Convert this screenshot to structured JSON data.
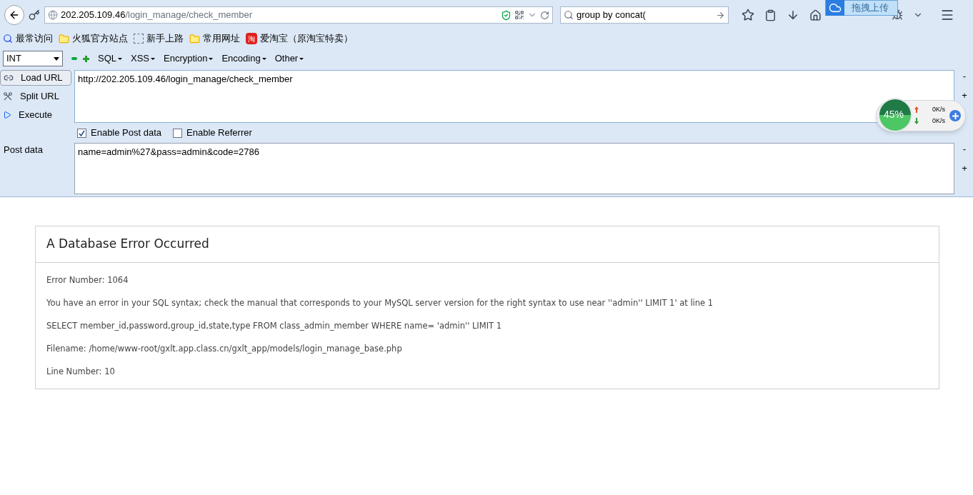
{
  "address_bar": {
    "host": "202.205.109.46",
    "path": "/login_manage/check_member"
  },
  "search": {
    "value": "group by concat("
  },
  "upload_tab": {
    "label": "拖拽上传"
  },
  "bookmarks": [
    {
      "kind": "search",
      "label": "最常访问"
    },
    {
      "kind": "folder",
      "label": "火狐官方站点"
    },
    {
      "kind": "blank",
      "label": "新手上路"
    },
    {
      "kind": "folder",
      "label": "常用网址"
    },
    {
      "kind": "taobao",
      "label": "爱淘宝（原淘宝特卖）",
      "badge": "淘"
    }
  ],
  "hackbar": {
    "select": "INT",
    "menus": [
      "SQL",
      "XSS",
      "Encryption",
      "Encoding",
      "Other"
    ],
    "actions": [
      {
        "kind": "load",
        "label": "Load URL"
      },
      {
        "kind": "split",
        "label": "Split URL"
      },
      {
        "kind": "execute",
        "label": "Execute"
      }
    ],
    "url": "http://202.205.109.46/login_manage/check_member",
    "options": [
      {
        "label": "Enable Post data",
        "checked": true
      },
      {
        "label": "Enable Referrer",
        "checked": false
      }
    ],
    "post_label": "Post data",
    "post_value": "name=admin%27&pass=admin&code=2786",
    "side_buttons": [
      "-",
      "+"
    ]
  },
  "speed_widget": {
    "percent": "45%",
    "up": "0K/s",
    "down": "0K/s"
  },
  "error": {
    "title": "A Database Error Occurred",
    "lines": [
      "Error Number: 1064",
      "You have an error in your SQL syntax; check the manual that corresponds to your MySQL server version for the right syntax to use near ''admin'' LIMIT 1' at line 1",
      "SELECT member_id,password,group_id,state,type FROM class_admin_member WHERE name= 'admin'' LIMIT 1",
      "Filename: /home/www-root/gxlt.app.class.cn/gxlt_app/models/login_manage_base.php",
      "Line Number: 10"
    ]
  }
}
